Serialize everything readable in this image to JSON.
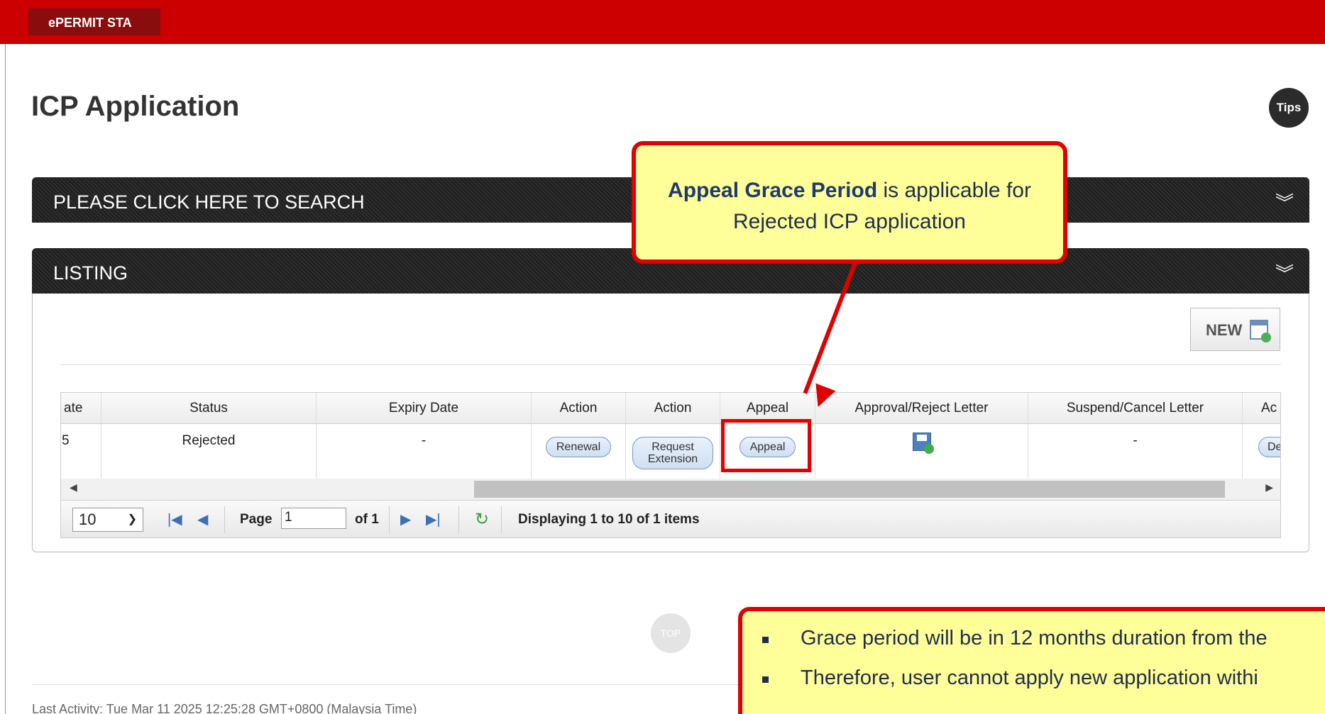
{
  "app": {
    "brand": "ePERMIT STA"
  },
  "page": {
    "title": "ICP Application",
    "tips_label": "Tips"
  },
  "panels": {
    "search_title": "PLEASE CLICK HERE TO SEARCH",
    "listing_title": "LISTING",
    "expand_icon": "double-chevron-down-icon"
  },
  "listing": {
    "new_label": "NEW",
    "columns": [
      "ate",
      "Status",
      "Expiry Date",
      "Action",
      "Action",
      "Appeal",
      "Approval/Reject Letter",
      "Suspend/Cancel Letter",
      "Ac"
    ],
    "row": {
      "date_fragment": "5",
      "status": "Rejected",
      "expiry_date": "-",
      "renewal_label": "Renewal",
      "extension_label": "Request Extension",
      "appeal_label": "Appeal",
      "approval_letter_icon": "save-document-icon",
      "suspend_letter": "-",
      "last_action_fragment": "De"
    }
  },
  "pager": {
    "page_size": "10",
    "page_label": "Page",
    "page_value": "1",
    "of_label": "of 1",
    "display_text": "Displaying 1 to 10 of 1 items"
  },
  "annotations": {
    "top_callout_bold": "Appeal Grace Period",
    "top_callout_rest": "is applicable for Rejected ICP application",
    "bottom_bullets": [
      "Grace period will be in 12 months duration from the",
      "Therefore, user cannot apply new application withi"
    ],
    "highlight_color": "#e00000",
    "callout_fill": "#ffff99"
  },
  "footer": {
    "top_label": "TOP",
    "last_activity": "Last Activity: Tue Mar 11 2025 12:25:28 GMT+0800 (Malaysia Time)"
  },
  "colors": {
    "brand_red": "#cc0000",
    "panel_dark": "#222222"
  }
}
